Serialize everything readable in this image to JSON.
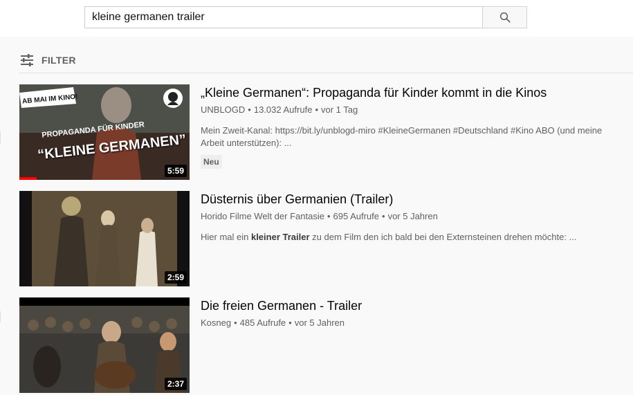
{
  "search": {
    "query": "kleine germanen trailer"
  },
  "filter": {
    "label": "FILTER"
  },
  "videos": [
    {
      "title": "„Kleine Germanen“: Propaganda für Kinder kommt in die Kinos",
      "channel": "UNBLOGD",
      "views": "13.032 Aufrufe",
      "age": "vor 1 Tag",
      "description": "Mein Zweit-Kanal: https://bit.ly/unblogd-miro #KleineGermanen #Deutschland #Kino ABO (und meine Arbeit unterstützen): ...",
      "badge": "Neu",
      "duration": "5:59",
      "progress": 0.1,
      "thumb_text": {
        "corner": "AB MAI IM KINO!",
        "line1": "PROPAGANDA FÜR KINDER",
        "line2": "“KLEINE GERMANEN”"
      }
    },
    {
      "title": "Düsternis über Germanien (Trailer)",
      "channel": "Horido Filme Welt der Fantasie",
      "views": "695 Aufrufe",
      "age": "vor 5 Jahren",
      "description_prefix": "Hier mal ein ",
      "description_bold": "kleiner Trailer",
      "description_suffix": " zu dem Film den ich bald bei den Externsteinen drehen möchte: ...",
      "duration": "2:59"
    },
    {
      "title": "Die freien Germanen - Trailer",
      "channel": "Kosneg",
      "views": "485 Aufrufe",
      "age": "vor 5 Jahren",
      "duration": "2:37"
    }
  ],
  "colors": {
    "progress": "#ff0000",
    "background": "#f9f9f9"
  },
  "icons": {
    "search": "search-icon",
    "filter": "filter-sliders-icon"
  }
}
